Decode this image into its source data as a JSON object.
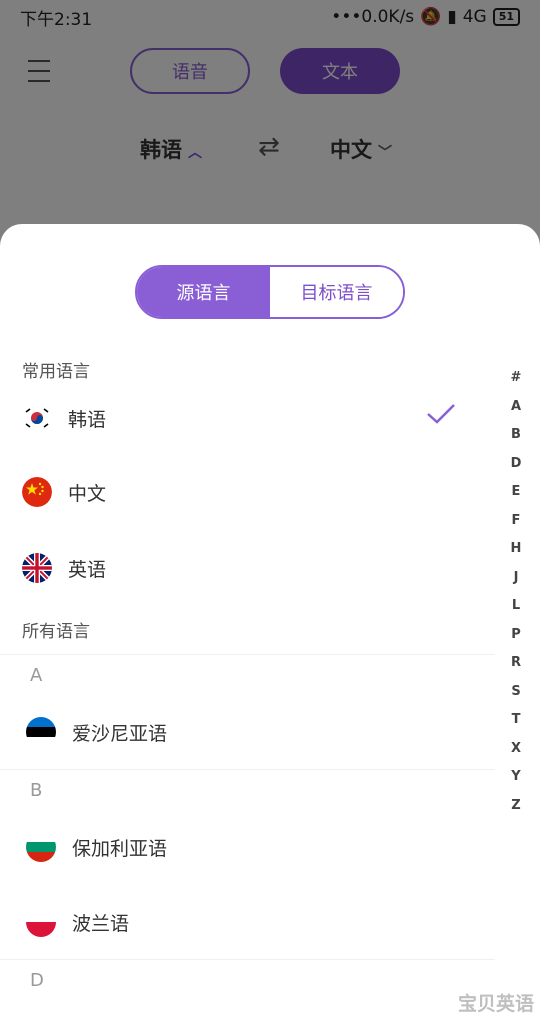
{
  "status": {
    "time": "下午2:31",
    "speed": "•••0.0K/s",
    "network": "4G",
    "battery": "51"
  },
  "top": {
    "voice_label": "语音",
    "text_label": "文本"
  },
  "langbar": {
    "source": "韩语",
    "target": "中文",
    "swap": "⇄"
  },
  "sheet": {
    "tabs": {
      "source": "源语言",
      "target": "目标语言"
    },
    "common_title": "常用语言",
    "common": [
      {
        "label": "韩语",
        "flag": "korea-flag",
        "selected": true
      },
      {
        "label": "中文",
        "flag": "china-flag",
        "selected": false
      },
      {
        "label": "英语",
        "flag": "uk-flag",
        "selected": false
      }
    ],
    "all_title": "所有语言",
    "groups": [
      {
        "letter": "A",
        "items": [
          "爱沙尼亚语"
        ]
      },
      {
        "letter": "B",
        "items": [
          "保加利亚语",
          "波兰语"
        ]
      },
      {
        "letter": "D",
        "items": []
      }
    ],
    "index": [
      "#",
      "A",
      "B",
      "D",
      "E",
      "F",
      "H",
      "J",
      "L",
      "P",
      "R",
      "S",
      "T",
      "X",
      "Y",
      "Z"
    ]
  },
  "colors": {
    "accent": "#8a5fd6"
  },
  "watermark": "宝贝英语"
}
